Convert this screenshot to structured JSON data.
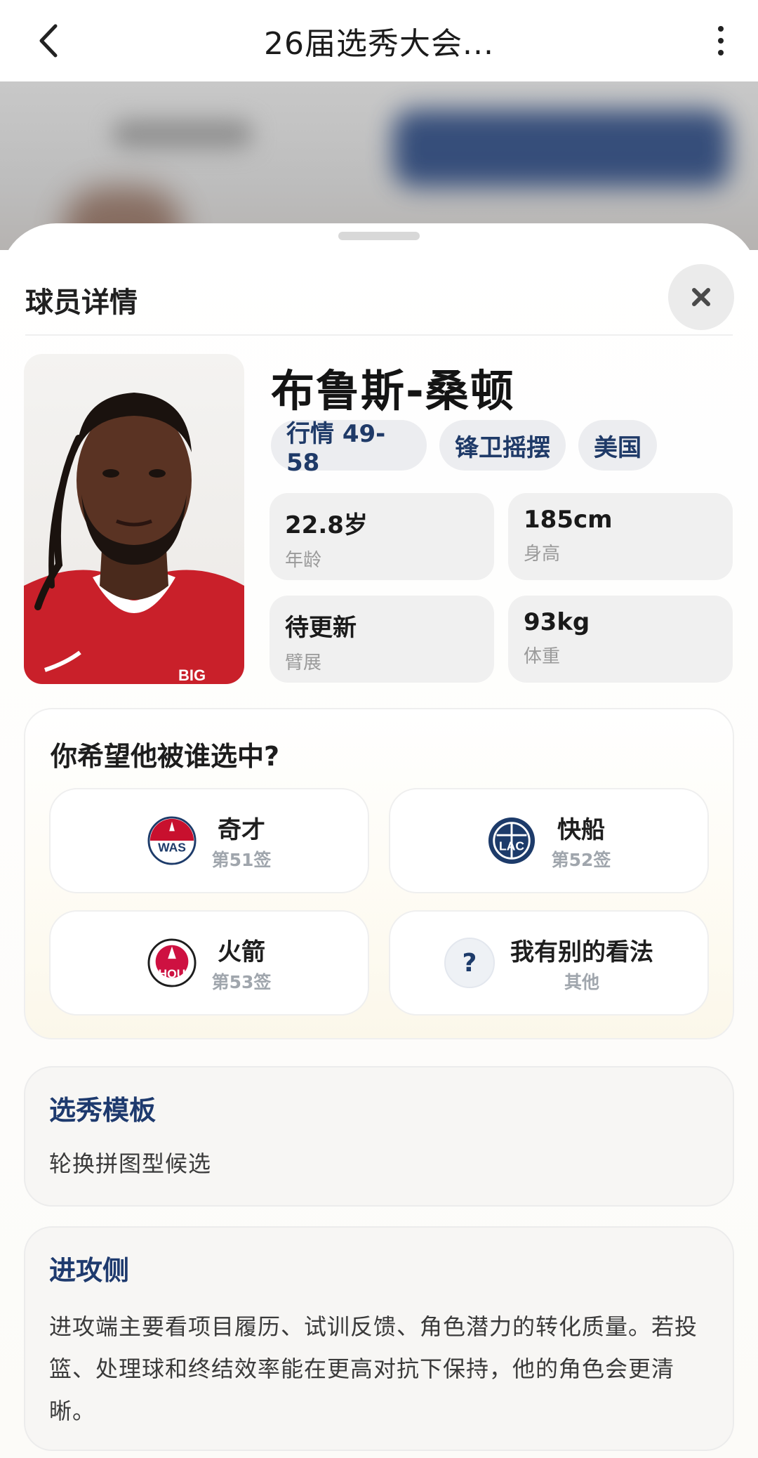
{
  "topbar": {
    "title": "26届选秀大会..."
  },
  "sheet": {
    "title": "球员详情"
  },
  "player": {
    "name": "布鲁斯-桑顿",
    "tags": [
      "行情 49-58",
      "锋卫摇摆",
      "美国"
    ],
    "stats": [
      {
        "value": "22.8岁",
        "label": "年龄"
      },
      {
        "value": "185cm",
        "label": "身高"
      },
      {
        "value": "待更新",
        "label": "臂展"
      },
      {
        "value": "93kg",
        "label": "体重"
      }
    ],
    "jersey_text": "BIG"
  },
  "vote": {
    "question": "你希望他被谁选中?",
    "options": [
      {
        "name": "奇才",
        "sub": "第51签",
        "logo_text": "WAS",
        "icon": "wizards-logo-icon"
      },
      {
        "name": "快船",
        "sub": "第52签",
        "logo_text": "LAC",
        "icon": "clippers-logo-icon"
      },
      {
        "name": "火箭",
        "sub": "第53签",
        "logo_text": "HOU",
        "icon": "rockets-logo-icon"
      },
      {
        "name": "我有别的看法",
        "sub": "其他",
        "logo_text": "?",
        "icon": "question-icon"
      }
    ]
  },
  "template_card": {
    "title": "选秀模板",
    "body": "轮换拼图型候选"
  },
  "offense_card": {
    "title": "进攻侧",
    "body": "进攻端主要看项目履历、试训反馈、角色潜力的转化质量。若投篮、处理球和终结效率能在更高对抗下保持，他的角色会更清晰。"
  },
  "colors": {
    "accent": "#1e3a6e",
    "tag_bg": "#ecedf0",
    "wizards_red": "#c8102e",
    "clippers_navy": "#1d3b6a",
    "rockets_red": "#ce1141"
  }
}
